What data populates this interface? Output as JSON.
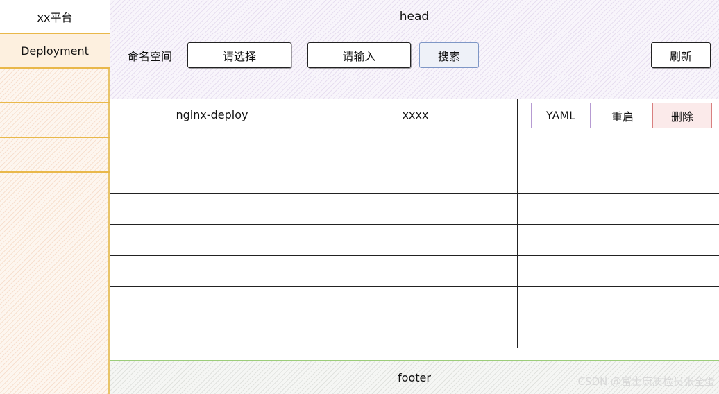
{
  "sidebar": {
    "title": "xx平台",
    "items": [
      {
        "label": "Deployment"
      },
      {
        "label": ""
      },
      {
        "label": ""
      },
      {
        "label": ""
      }
    ]
  },
  "header": {
    "title": "head"
  },
  "toolbar": {
    "namespace_label": "命名空间",
    "select_value": "请选择",
    "input_value": "请输入",
    "search_label": "搜索",
    "refresh_label": "刷新"
  },
  "table": {
    "rows": [
      {
        "name": "nginx-deploy",
        "info": "xxxx"
      }
    ],
    "actions": {
      "yaml": "YAML",
      "restart": "重启",
      "delete": "删除"
    }
  },
  "footer": {
    "text": "footer"
  },
  "watermark": "CSDN @富士康质检员张全蛋",
  "colors": {
    "sidebar_border": "#e9b84a",
    "footer_border": "#9ccc7a",
    "search_border": "#7e97c6",
    "yaml_border": "#b69bd2",
    "restart_border": "#8dcb7a",
    "delete_border": "#d98080"
  }
}
